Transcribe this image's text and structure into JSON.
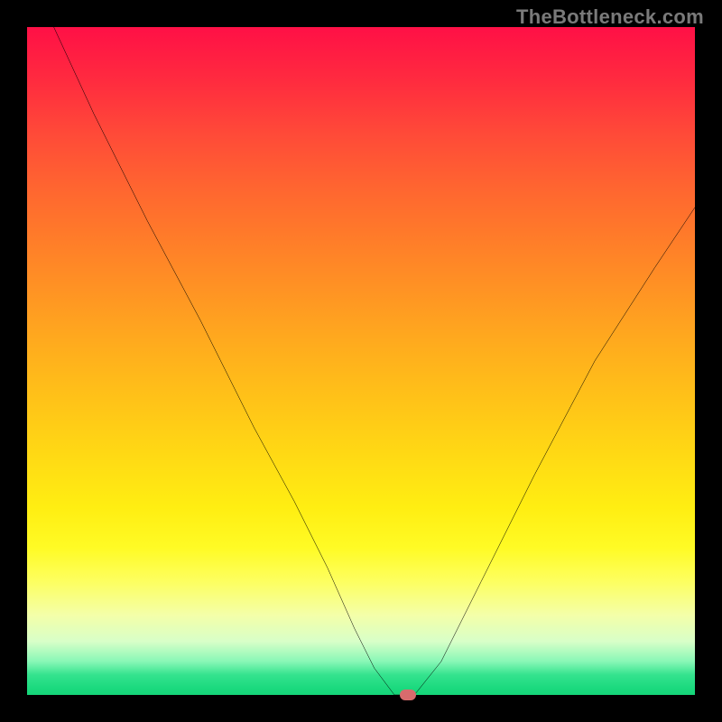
{
  "watermark": "TheBottleneck.com",
  "chart_data": {
    "type": "line",
    "title": "",
    "xlabel": "",
    "ylabel": "",
    "xlim": [
      0,
      100
    ],
    "ylim": [
      0,
      100
    ],
    "grid": false,
    "legend": false,
    "background_gradient": {
      "type": "vertical",
      "stops": [
        {
          "pos": 0.0,
          "color": "#ff1046"
        },
        {
          "pos": 0.5,
          "color": "#ffad1d"
        },
        {
          "pos": 0.8,
          "color": "#fffb25"
        },
        {
          "pos": 0.92,
          "color": "#d8ffc8"
        },
        {
          "pos": 1.0,
          "color": "#15d679"
        }
      ]
    },
    "series": [
      {
        "name": "bottleneck-curve",
        "color": "#000000",
        "x": [
          4,
          10,
          18,
          26,
          34,
          40,
          45,
          49,
          52,
          55,
          58,
          62,
          68,
          76,
          85,
          94,
          100
        ],
        "y": [
          100,
          87,
          71,
          56,
          40,
          29,
          19,
          10,
          4,
          0,
          0,
          5,
          17,
          33,
          50,
          64,
          73
        ]
      }
    ],
    "marker": {
      "name": "optimal-point",
      "x": 57,
      "y": 0,
      "color": "#d86b6d"
    }
  }
}
